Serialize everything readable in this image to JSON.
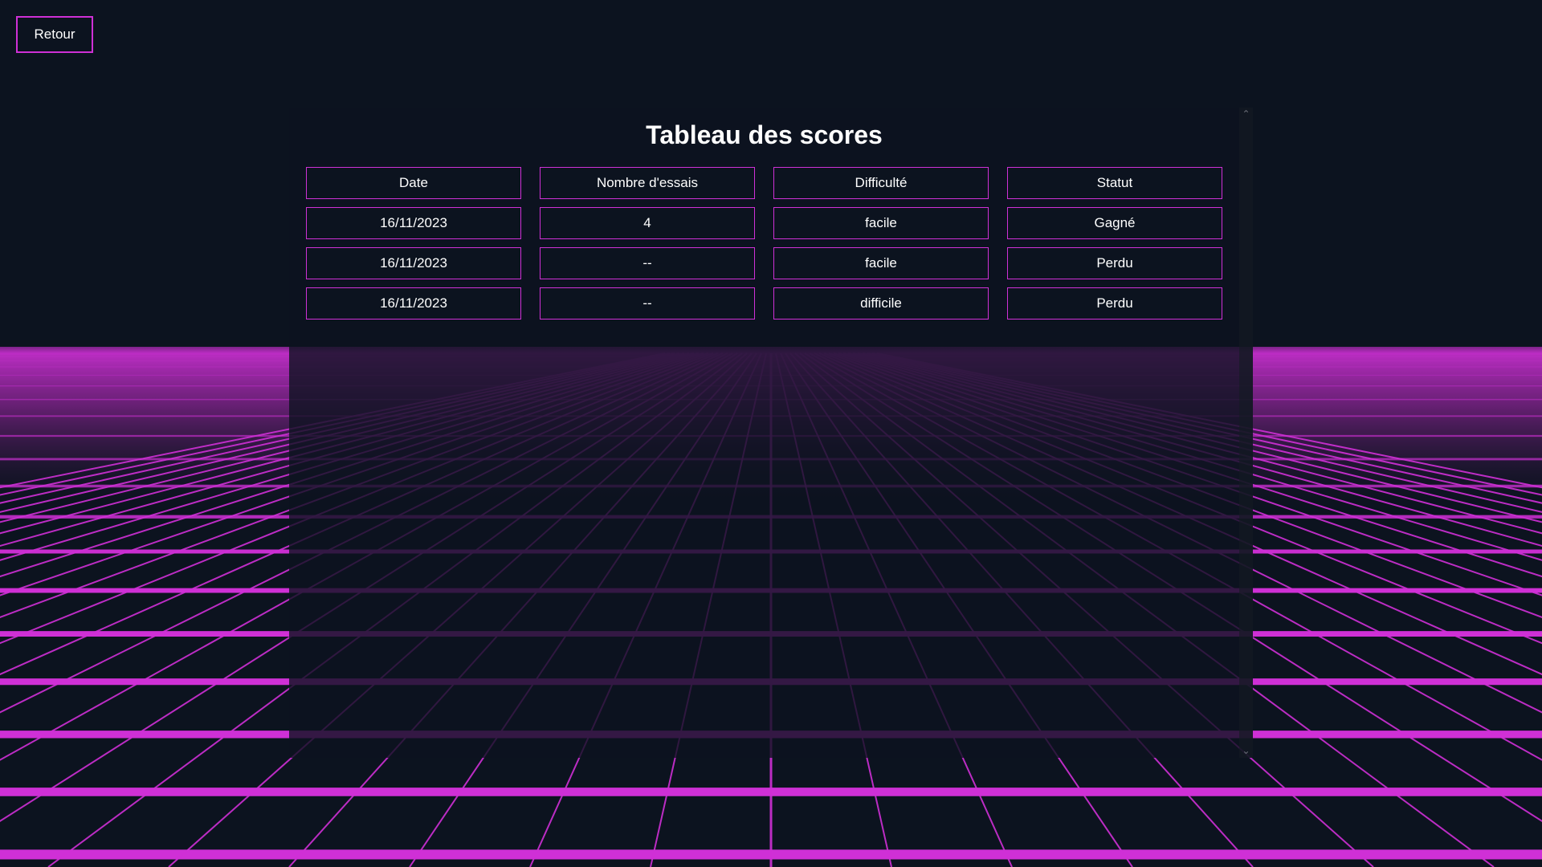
{
  "back_button": {
    "label": "Retour"
  },
  "scores": {
    "title": "Tableau des scores",
    "columns": [
      "Date",
      "Nombre d'essais",
      "Difficulté",
      "Statut"
    ],
    "rows": [
      [
        "16/11/2023",
        "4",
        "facile",
        "Gagné"
      ],
      [
        "16/11/2023",
        "--",
        "facile",
        "Perdu"
      ],
      [
        "16/11/2023",
        "--",
        "difficile",
        "Perdu"
      ]
    ]
  },
  "scrollbar": {
    "up_icon": "chevron-up-icon",
    "down_icon": "chevron-down-icon"
  },
  "theme": {
    "background": "#0c131f",
    "accent": "#cf30d6",
    "text": "#ffffff"
  }
}
